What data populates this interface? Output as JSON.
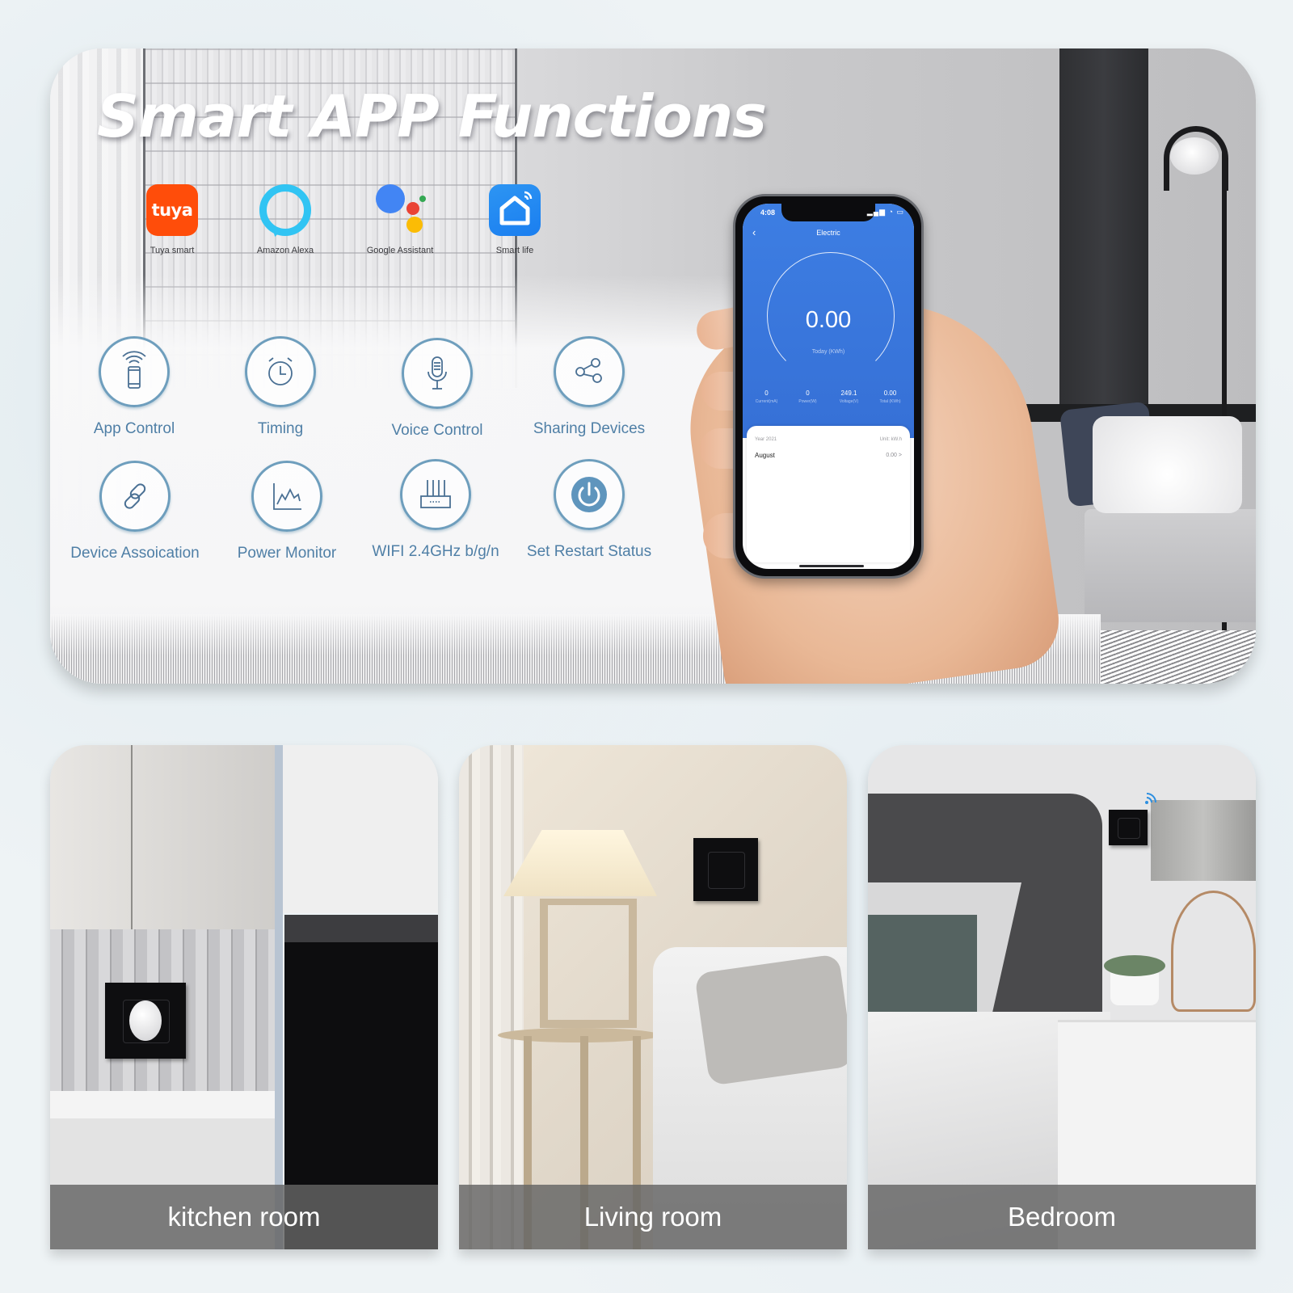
{
  "hero": {
    "title": "Smart APP Functions",
    "partners": [
      {
        "name": "Tuya smart",
        "logo_text": "tuya",
        "icon": "tuya-logo-icon",
        "color": "#ff4d0a"
      },
      {
        "name": "Amazon Alexa",
        "icon": "alexa-logo-icon",
        "color": "#31c4f3"
      },
      {
        "name": "Google Assistant",
        "icon": "google-assistant-logo-icon",
        "colors": [
          "#4285f4",
          "#ea4335",
          "#fbbc05",
          "#34a853"
        ]
      },
      {
        "name": "Smart life",
        "icon": "smart-life-logo-icon",
        "color": "#1a7ef0"
      }
    ],
    "features": [
      {
        "label": "App Control",
        "icon": "phone-remote-icon"
      },
      {
        "label": "Timing",
        "icon": "alarm-clock-icon"
      },
      {
        "label": "Voice Control",
        "icon": "microphone-icon"
      },
      {
        "label": "Sharing Devices",
        "icon": "share-icon"
      },
      {
        "label": "Device Assoication",
        "icon": "link-icon"
      },
      {
        "label": "Power Monitor",
        "icon": "line-chart-icon"
      },
      {
        "label": "WIFI 2.4GHz b/g/n",
        "icon": "router-icon"
      },
      {
        "label": "Set Restart Status",
        "icon": "power-icon"
      }
    ],
    "accent_color": "#4f7fa6"
  },
  "phone": {
    "status_time": "4:08",
    "status_icons": "signal wifi battery",
    "screen_title": "Electric",
    "gauge_value": "0.00",
    "gauge_label": "Today (KWh)",
    "stats": [
      {
        "value": "0",
        "label": "Current(mA)"
      },
      {
        "value": "0",
        "label": "Power(W)"
      },
      {
        "value": "249.1",
        "label": "Voltage(V)"
      },
      {
        "value": "0.00",
        "label": "Total (KWh)"
      }
    ],
    "history": {
      "year": "Year 2021",
      "unit": "Unit: kW.h",
      "rows": [
        {
          "month": "August",
          "value": "0.00 >"
        }
      ]
    },
    "theme_color": "#3d7ee3"
  },
  "rooms": [
    {
      "label": "kitchen room"
    },
    {
      "label": "Living room"
    },
    {
      "label": "Bedroom"
    }
  ]
}
